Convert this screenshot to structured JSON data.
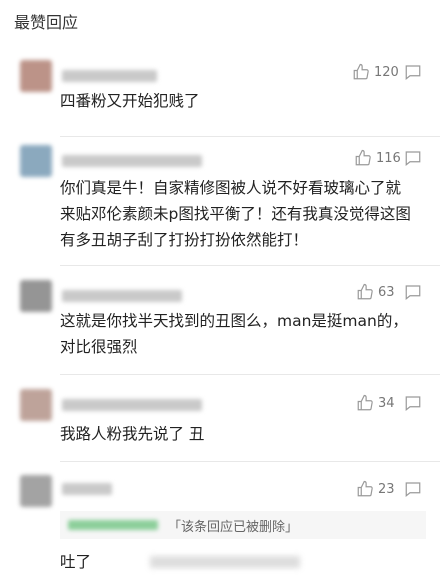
{
  "section": {
    "title": "最赞回应"
  },
  "comments": [
    {
      "likes": "120",
      "content": "四番粉又开始犯贱了",
      "avatar_color": "#b5887c",
      "name_color": "#c9c9c9"
    },
    {
      "likes": "116",
      "content_lines": [
        "你们真是牛！自家精修图被人说不好看玻璃心了就",
        "来贴邓伦素颜未p图找平衡了！还有我真没觉得这图",
        "有多丑胡子刮了打扮打扮依然能打！"
      ],
      "avatar_color": "#7fa0b8",
      "name_color": "#c9c9c9"
    },
    {
      "likes": "63",
      "content_lines": [
        "这就是你找半天找到的丑图么，man是挺man的，",
        "对比很强烈"
      ],
      "avatar_color": "#8a8a8a",
      "name_color": "#c9c9c9"
    },
    {
      "likes": "34",
      "content": "我路人粉我先说了 丑",
      "avatar_color": "#b89a90",
      "name_color": "#c9c9c9"
    },
    {
      "likes": "23",
      "deleted_reply": "「该条回应已被删除」",
      "content": "吐了",
      "avatar_color": "#9a9a9a",
      "name_color": "#c9c9c9"
    }
  ],
  "colors": {
    "icon": "#9a9a9a",
    "divider": "#e8e8e8",
    "deleted_name": "#8ccf9a"
  }
}
